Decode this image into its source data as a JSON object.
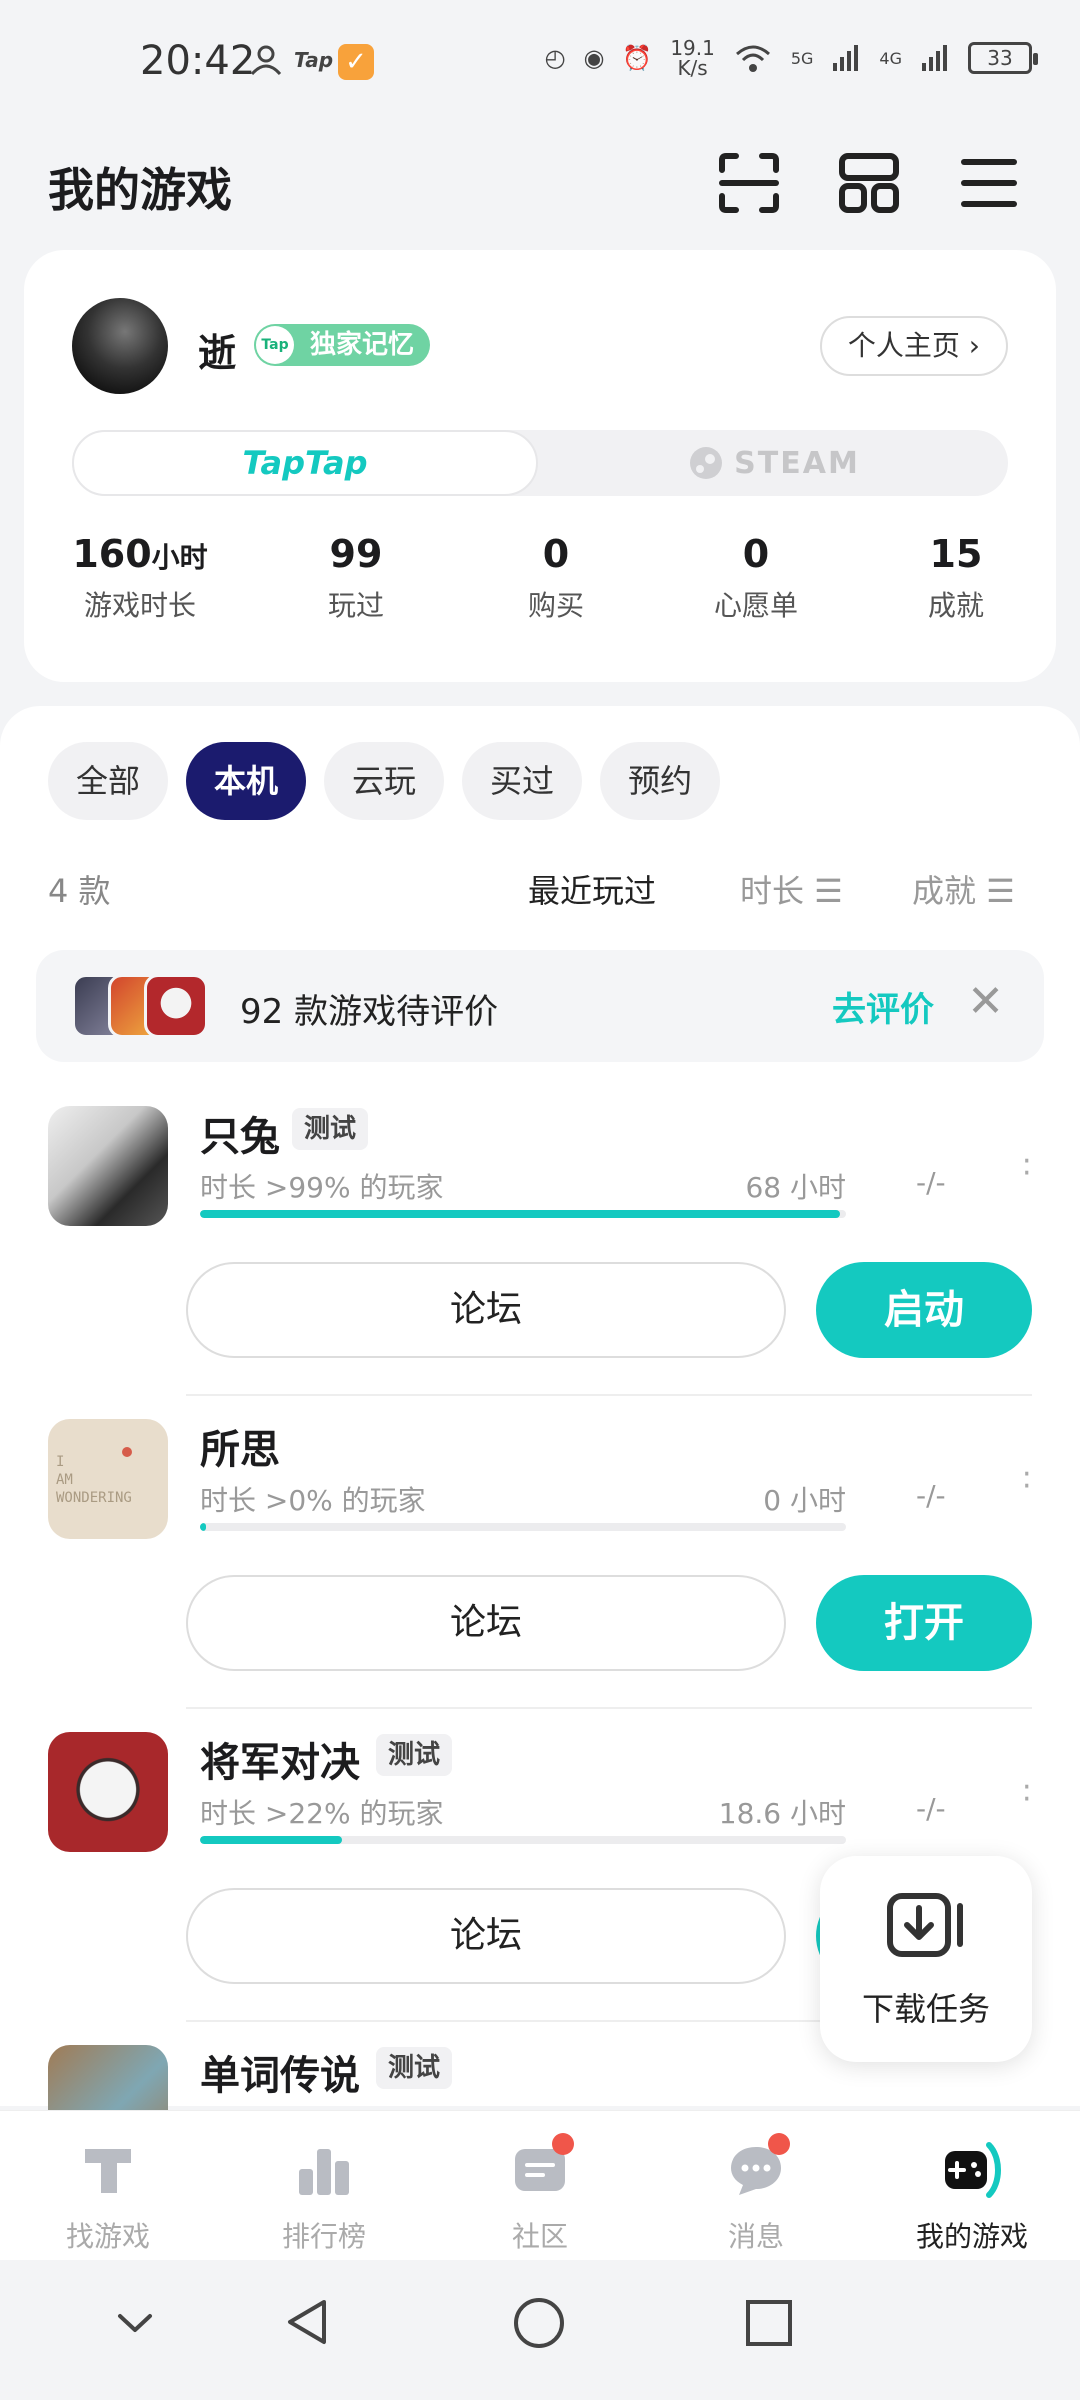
{
  "status_bar": {
    "time": "20:42",
    "app_badge": "Tap",
    "net_speed": "19.1\nK/s",
    "net_speed_top": "19.1",
    "net_speed_bottom": "K/s",
    "sim1": "5G",
    "sim2": "4G",
    "battery": "33"
  },
  "header": {
    "title": "我的游戏"
  },
  "profile": {
    "name": "逝",
    "badge": "独家记忆",
    "badge_icon_text": "Tap",
    "homepage_label": "个人主页 ›",
    "platform_active": "TapTap",
    "platform_inactive": "STEAM",
    "stats": [
      {
        "value": "160",
        "unit": "小时",
        "label": "游戏时长"
      },
      {
        "value": "99",
        "unit": "",
        "label": "玩过"
      },
      {
        "value": "0",
        "unit": "",
        "label": "购买"
      },
      {
        "value": "0",
        "unit": "",
        "label": "心愿单"
      },
      {
        "value": "15",
        "unit": "",
        "label": "成就"
      }
    ]
  },
  "filters": [
    "全部",
    "本机",
    "云玩",
    "买过",
    "预约"
  ],
  "active_filter": "本机",
  "sort": {
    "count": "4 款",
    "options": [
      "最近玩过",
      "时长 ☰",
      "成就 ☰"
    ],
    "active": "最近玩过"
  },
  "review_banner": {
    "text": "92 款游戏待评价",
    "action": "去评价"
  },
  "games": [
    {
      "name": "只兔",
      "tag": "测试",
      "sub": "时长 >99% 的玩家",
      "hours": "68 小时",
      "achieve": "-/-",
      "progress": 0.99,
      "forum": "论坛",
      "action": "启动"
    },
    {
      "name": "所思",
      "tag": "",
      "sub": "时长 >0% 的玩家",
      "hours": "0 小时",
      "achieve": "-/-",
      "progress": 0.0,
      "forum": "论坛",
      "action": "打开"
    },
    {
      "name": "将军对决",
      "tag": "测试",
      "sub": "时长 >22% 的玩家",
      "hours": "18.6 小时",
      "achieve": "-/-",
      "progress": 0.22,
      "forum": "论坛",
      "action": ""
    },
    {
      "name": "单词传说",
      "tag": "测试",
      "sub": "",
      "hours": "",
      "achieve": "",
      "progress": 0.0,
      "forum": "",
      "action": ""
    }
  ],
  "download_tasks": {
    "label": "下载任务"
  },
  "bottom_nav": [
    {
      "label": "找游戏",
      "icon": "find-games-icon",
      "dot": false
    },
    {
      "label": "排行榜",
      "icon": "ranking-icon",
      "dot": false
    },
    {
      "label": "社区",
      "icon": "community-icon",
      "dot": true
    },
    {
      "label": "消息",
      "icon": "messages-icon",
      "dot": true
    },
    {
      "label": "我的游戏",
      "icon": "my-games-icon",
      "dot": false
    }
  ],
  "colors": {
    "accent": "#14c9c0",
    "chip_active": "#1b1b6e",
    "badge_green": "#6fd3a3",
    "notify_red": "#f0564a"
  }
}
